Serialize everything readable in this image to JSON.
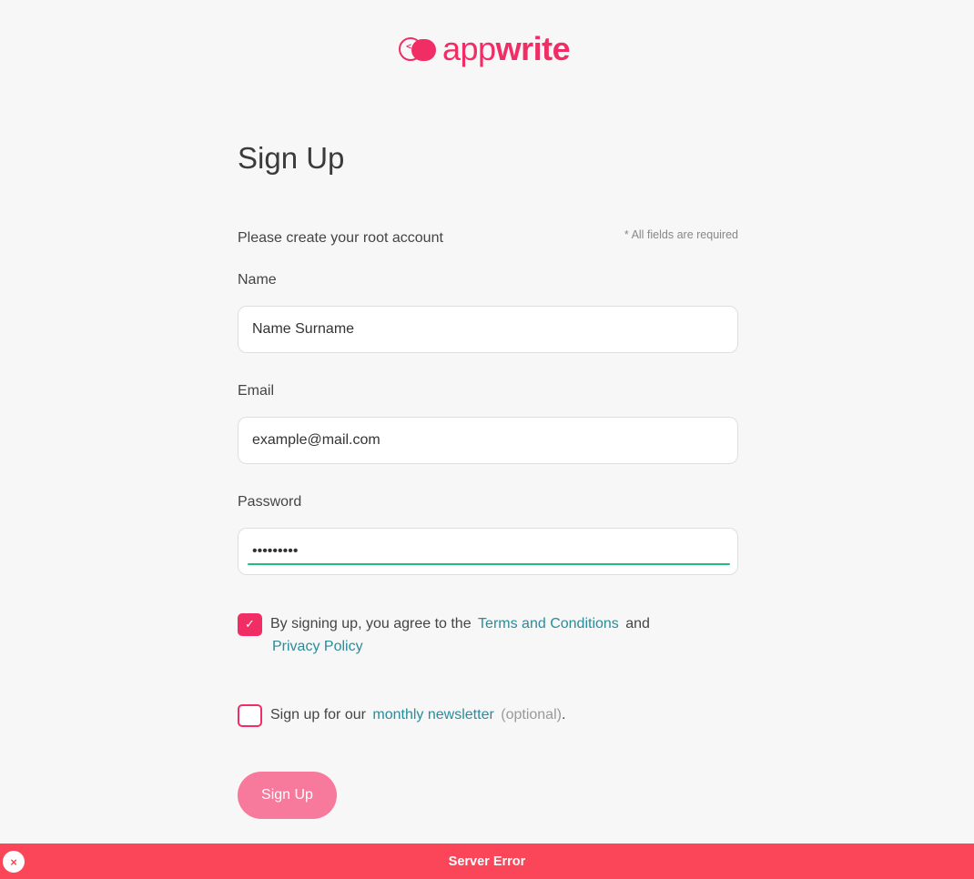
{
  "brand": {
    "name_light": "app",
    "name_bold": "write",
    "logo_code": "</>",
    "accent_color": "#f02e65"
  },
  "page": {
    "title": "Sign Up",
    "intro": "Please create your root account",
    "required_note": "* All fields are required"
  },
  "form": {
    "name": {
      "label": "Name",
      "value": "Name Surname",
      "placeholder": ""
    },
    "email": {
      "label": "Email",
      "value": "example@mail.com",
      "placeholder": ""
    },
    "password": {
      "label": "Password",
      "value": "•••••••••"
    },
    "terms": {
      "checked": true,
      "text_before": "By signing up, you agree to the",
      "terms_link": "Terms and Conditions",
      "text_and": "and",
      "privacy_link": "Privacy Policy"
    },
    "newsletter": {
      "checked": false,
      "text_before": "Sign up for our",
      "newsletter_link": "monthly newsletter",
      "optional": "(optional)",
      "period": "."
    },
    "submit_label": "Sign Up"
  },
  "notification": {
    "message": "Server Error",
    "close_icon": "×",
    "color": "#fb4558"
  },
  "icons": {
    "check": "✓"
  }
}
